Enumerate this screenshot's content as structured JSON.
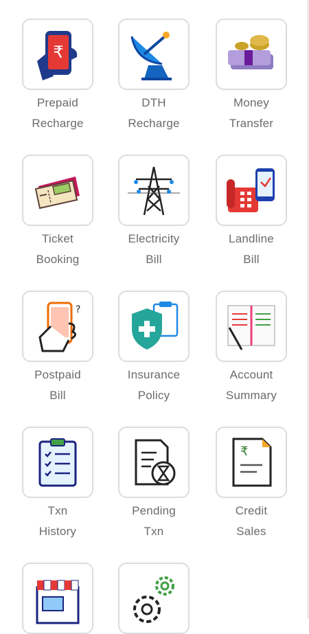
{
  "tiles": [
    {
      "line1": "Prepaid",
      "line2": "Recharge",
      "icon": "mobile-rupee-icon"
    },
    {
      "line1": "DTH",
      "line2": "Recharge",
      "icon": "satellite-dish-icon"
    },
    {
      "line1": "Money",
      "line2": "Transfer",
      "icon": "cash-bundle-icon"
    },
    {
      "line1": "Ticket",
      "line2": "Booking",
      "icon": "ticket-icon"
    },
    {
      "line1": "Electricity",
      "line2": "Bill",
      "icon": "power-tower-icon"
    },
    {
      "line1": "Landline",
      "line2": "Bill",
      "icon": "telephone-icon"
    },
    {
      "line1": "Postpaid",
      "line2": "Bill",
      "icon": "phone-in-hand-icon"
    },
    {
      "line1": "Insurance",
      "line2": "Policy",
      "icon": "shield-plus-icon"
    },
    {
      "line1": "Account",
      "line2": "Summary",
      "icon": "ledger-book-icon"
    },
    {
      "line1": "Txn",
      "line2": "History",
      "icon": "clipboard-checklist-icon"
    },
    {
      "line1": "Pending",
      "line2": "Txn",
      "icon": "hourglass-document-icon"
    },
    {
      "line1": "Credit",
      "line2": "Sales",
      "icon": "rupee-document-icon"
    },
    {
      "line1": "",
      "line2": "",
      "icon": "storefront-icon"
    },
    {
      "line1": "",
      "line2": "",
      "icon": "gears-icon"
    }
  ]
}
